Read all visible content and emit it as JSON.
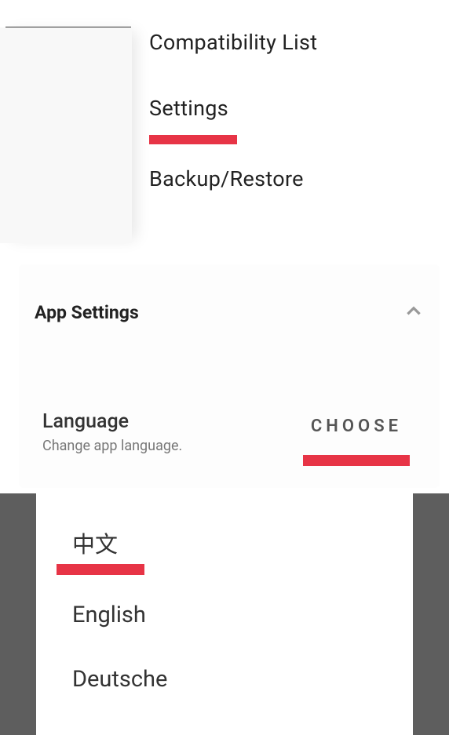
{
  "menu": {
    "item1": "Compatibility List",
    "item2": "Settings",
    "item3": "Backup/Restore"
  },
  "card": {
    "title": "App Settings",
    "language": {
      "title": "Language",
      "subtitle": "Change app language.",
      "choose": "CHOOSE"
    }
  },
  "languages": {
    "opt1": "中文",
    "opt2": "English",
    "opt3": "Deutsche"
  }
}
